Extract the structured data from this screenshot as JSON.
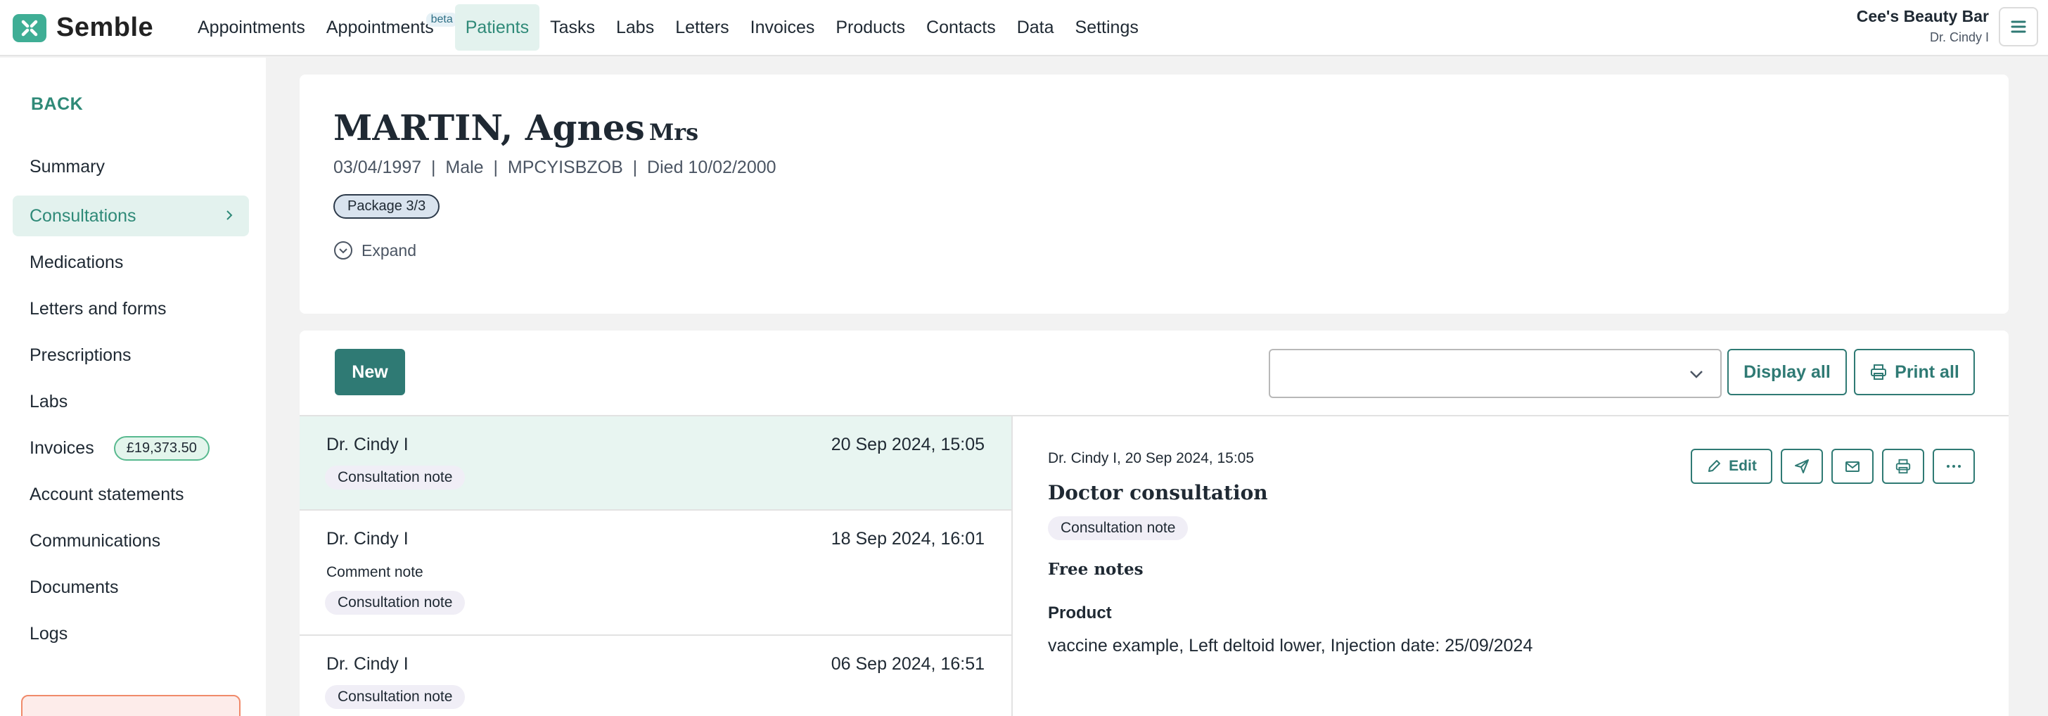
{
  "brand": {
    "name": "Semble"
  },
  "nav": [
    {
      "label": "Appointments"
    },
    {
      "label": "Appointments",
      "badge": "beta"
    },
    {
      "label": "Patients",
      "active": true
    },
    {
      "label": "Tasks"
    },
    {
      "label": "Labs"
    },
    {
      "label": "Letters"
    },
    {
      "label": "Invoices"
    },
    {
      "label": "Products"
    },
    {
      "label": "Contacts"
    },
    {
      "label": "Data"
    },
    {
      "label": "Settings"
    }
  ],
  "org": {
    "name": "Cee's Beauty Bar",
    "user": "Dr. Cindy I"
  },
  "sidebar": {
    "back": "BACK",
    "items": [
      {
        "label": "Summary"
      },
      {
        "label": "Consultations",
        "active": true
      },
      {
        "label": "Medications"
      },
      {
        "label": "Letters and forms"
      },
      {
        "label": "Prescriptions"
      },
      {
        "label": "Labs"
      },
      {
        "label": "Invoices",
        "badge": "£19,373.50"
      },
      {
        "label": "Account statements"
      },
      {
        "label": "Communications"
      },
      {
        "label": "Documents"
      },
      {
        "label": "Logs"
      }
    ]
  },
  "patient": {
    "name": "MARTIN, Agnes",
    "title": "Mrs",
    "details": "03/04/1997  |  Male  |  MPCYISBZOB  |  Died 10/02/2000",
    "package": "Package 3/3",
    "expand": "Expand"
  },
  "toolbar": {
    "new": "New",
    "filter_value": "",
    "display_all": "Display all",
    "print_all": "Print all"
  },
  "consultations": [
    {
      "doctor": "Dr. Cindy I",
      "date": "20 Sep 2024, 15:05",
      "sub": "",
      "tag": "Consultation note",
      "selected": true
    },
    {
      "doctor": "Dr. Cindy I",
      "date": "18 Sep 2024, 16:01",
      "sub": "Comment note",
      "tag": "Consultation note"
    },
    {
      "doctor": "Dr. Cindy I",
      "date": "06 Sep 2024, 16:51",
      "sub": "",
      "tag": "Consultation note"
    }
  ],
  "detail": {
    "meta": "Dr. Cindy I, 20 Sep 2024, 15:05",
    "title": "Doctor consultation",
    "tag": "Consultation note",
    "free_notes": "Free notes",
    "product_label": "Product",
    "product_value": "vaccine example, Left deltoid lower, Injection date: 25/09/2024",
    "edit": "Edit"
  },
  "colors": {
    "accent": "#2f7a74",
    "active_bg": "#e3f2ee",
    "brand": "#3fae95"
  }
}
